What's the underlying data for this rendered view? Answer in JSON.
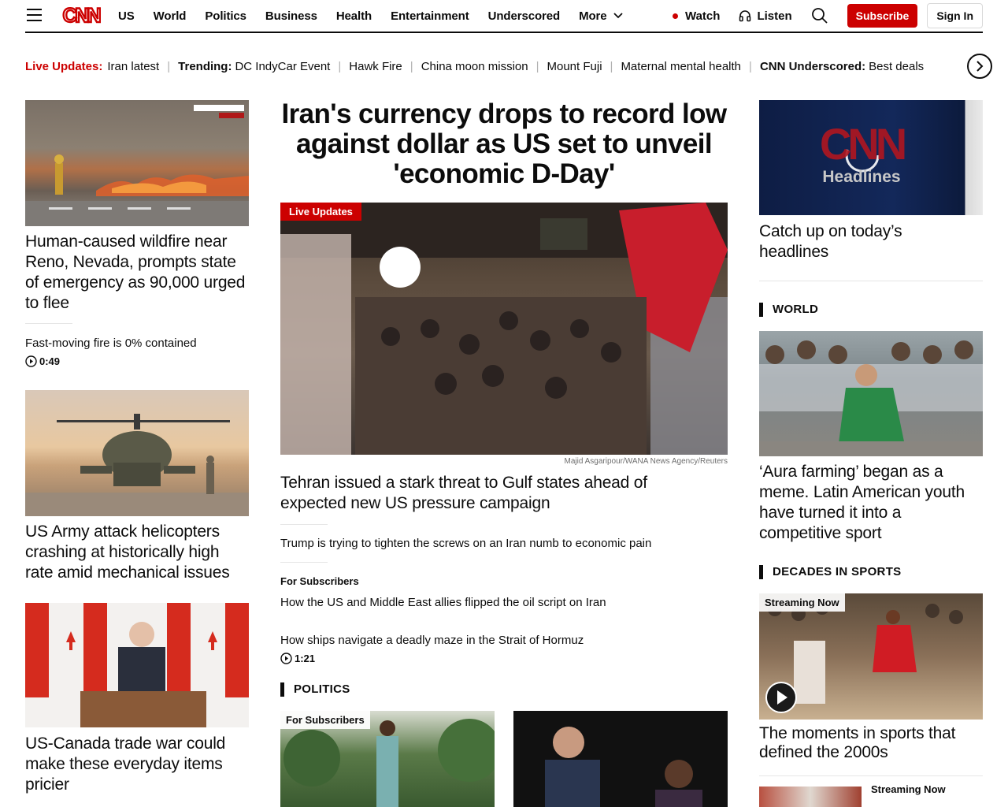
{
  "header": {
    "nav": [
      "US",
      "World",
      "Politics",
      "Business",
      "Health",
      "Entertainment",
      "Underscored",
      "More"
    ],
    "watch": "Watch",
    "listen": "Listen",
    "subscribe": "Subscribe",
    "signin": "Sign In",
    "brand_color": "#cc0000"
  },
  "trending": {
    "live_label": "Live Updates:",
    "live_item": "Iran latest",
    "trending_label": "Trending:",
    "items": [
      "DC IndyCar Event",
      "Hawk Fire",
      "China moon mission",
      "Mount Fuji",
      "Maternal mental health"
    ],
    "underscored_label": "CNN Underscored:",
    "underscored_item": "Best deals"
  },
  "left": {
    "story1": {
      "headline": "Human-caused wildfire near Reno, Nevada, prompts state of emergency as 90,000 urged to flee",
      "subtext": "Fast-moving fire is 0% contained",
      "duration": "0:49"
    },
    "story2": {
      "headline": "US Army attack helicopters crashing at historically high rate amid mechanical issues"
    },
    "story3": {
      "headline": "US-Canada trade war could make these everyday items pricier"
    }
  },
  "center": {
    "headline": "Iran's currency drops to record low against dollar as US set to unveil 'economic D-Day'",
    "tag": "Live Updates",
    "credit": "Majid Asgaripour/WANA News Agency/Reuters",
    "subhead": "Tehran issued a stark threat to Gulf states ahead of expected new US pressure campaign",
    "link1": "Trump is trying to tighten the screws on an Iran numb to economic pain",
    "subscribers_label": "For Subscribers",
    "link2": "How the US and Middle East allies flipped the oil script on Iran",
    "link3": "How ships navigate a deadly maze in the Strait of Hormuz",
    "link3_duration": "1:21",
    "politics_section": "POLITICS",
    "politics_tag": "For Subscribers"
  },
  "right": {
    "video_logo": "CNN",
    "video_word": "Headlines",
    "video_headline": "Catch up on today’s headlines",
    "world_section": "WORLD",
    "world_headline": "‘Aura farming’ began as a meme. Latin American youth have turned it into a competitive sport",
    "decades_section": "DECADES IN SPORTS",
    "streaming_tag": "Streaming Now",
    "decades_headline": "The moments in sports that defined the 2000s",
    "small_streaming": "Streaming Now"
  }
}
